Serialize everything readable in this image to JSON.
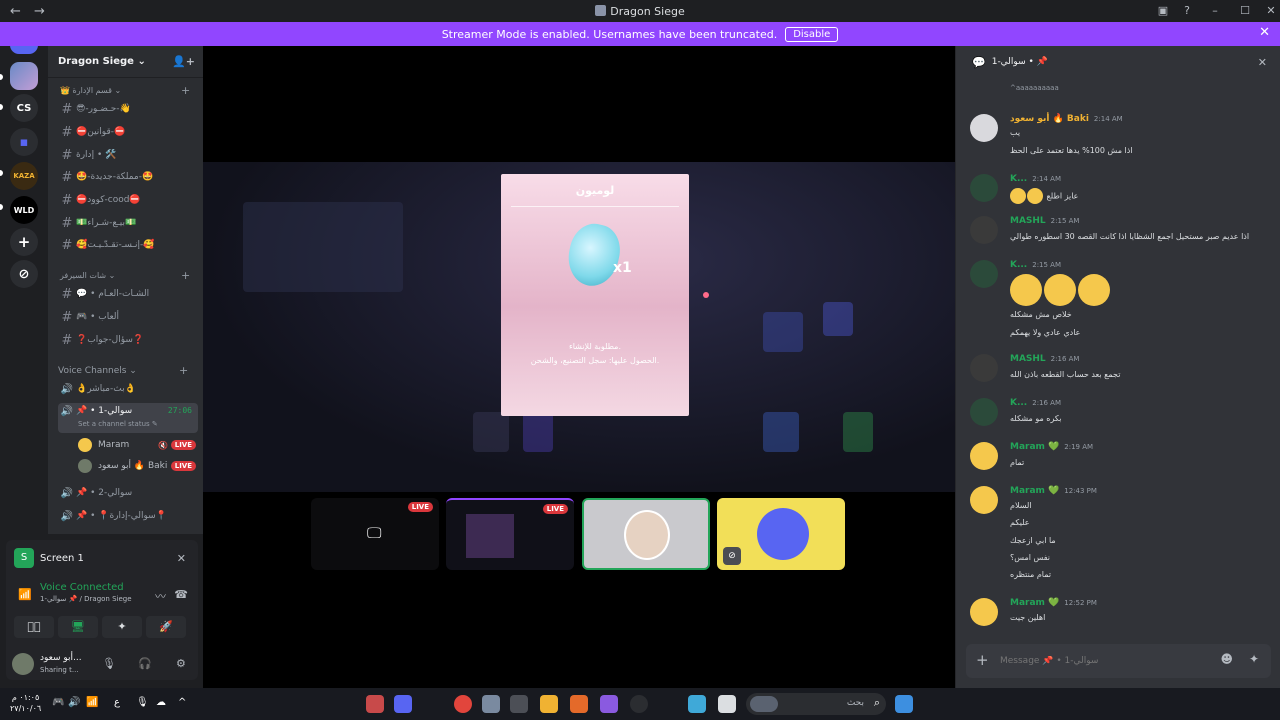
{
  "window": {
    "title": "Dragon Siege",
    "back": "←",
    "forward": "→",
    "min": "–",
    "max": "☐",
    "close": "✕",
    "help": "?",
    "inbox": "▣"
  },
  "banner": {
    "text": "Streamer Mode is enabled. Usernames have been truncated.",
    "button": "Disable",
    "close": "✕"
  },
  "rail": {
    "servers": [
      {
        "label": "CS"
      },
      {
        "label": "KAZA"
      },
      {
        "label": "WLD"
      }
    ],
    "add": "+",
    "explore": "⊘"
  },
  "guild": {
    "name": "Dragon Siege ⌄",
    "invite": "👤+"
  },
  "categories": {
    "admin": "👑 قسم الإدارة ⌄",
    "chat": "شات السيرفر ⌄",
    "voice": "Voice Channels ⌄",
    "plus": "+"
  },
  "text_channels": [
    "😎-حـضـور-👋",
    "⛔قوانين-⛔",
    "إدارة • 🛠️",
    "🤩-مملكة-جديدة-🤩",
    "⛔كوود-cood⛔",
    "💵بيـع-شـراء💵",
    "🥰إنـسـ-تقـدّـيـت-🥰",
    "💬 • الشـات-العـام",
    "🎮 • ألعاب",
    "❓سؤال-جواب❓"
  ],
  "voice_channels": [
    {
      "name": "👌بث-مباشر👌",
      "active": false
    },
    {
      "name": "📌 • سوالي-1",
      "active": true,
      "time": "27:06",
      "status": "Set a channel status ✎"
    },
    {
      "name": "📌 • سوالي-2",
      "active": false
    },
    {
      "name": "📌 • 📍سوالي-إدارة📍",
      "active": false
    }
  ],
  "vc_members": [
    {
      "name": "Maram",
      "badge": "LIVE",
      "icon": "🔇"
    },
    {
      "name": "أبو سعود 🔥 Baki",
      "badge": "LIVE"
    }
  ],
  "voice_panel": {
    "screen_label": "Screen 1",
    "status": "Voice Connected",
    "sub": "سوالي-1 📌 / Dragon Siege",
    "user_name": "أبو سعود...",
    "user_status": "Sharing t...",
    "buttons": [
      "📷⃠",
      "🖥",
      "✦",
      "🚀"
    ],
    "icons": {
      "mic": "🎙",
      "headset": "🎧",
      "gear": "⚙",
      "signal": "📶",
      "noise": "〰",
      "hangup": "☎",
      "close": "✕"
    }
  },
  "stage": {
    "card": {
      "title": "لوميون",
      "qty": "x1",
      "desc1": "مطلوبة للإنشاء.",
      "desc2": "الحصول عليها: سجل التصنيع، والشحن."
    },
    "tiles": [
      {
        "badge": "LIVE"
      },
      {
        "badge": "LIVE"
      },
      {
        "badge": ""
      },
      {
        "badge": ""
      }
    ]
  },
  "chat": {
    "header": "سوالي-1 • 📌",
    "header_close": "✕",
    "top_fragment": "^aaaaaaaaaa",
    "messages": [
      {
        "name": "أبو سعود 🔥 Baki",
        "time": "2:14 AM",
        "color": "#f0b232",
        "lines": [
          "يب",
          "اذا مش 100% يدها تعتمد على الحظ"
        ]
      },
      {
        "name": "K...",
        "time": "2:14 AM",
        "color": "#23a559",
        "lines": [
          "عايز اطلع"
        ],
        "emoji_after": 2
      },
      {
        "name": "MASHL",
        "time": "2:15 AM",
        "color": "#23a559",
        "lines": [
          "اذا عديم صبر مستحيل اجمع الشظايا اذا كانت القصه 30 اسطوره طوالي"
        ]
      },
      {
        "name": "K...",
        "time": "2:15 AM",
        "color": "#23a559",
        "lines": [
          "خلاص مش مشكله",
          "عادي عادي ولا يهمكم"
        ],
        "big_emoji": 3
      },
      {
        "name": "MASHL",
        "time": "2:16 AM",
        "color": "#23a559",
        "lines": [
          "تجمع بعد حساب القطعه باذن الله"
        ]
      },
      {
        "name": "K...",
        "time": "2:16 AM",
        "color": "#23a559",
        "lines": [
          "بكره مو مشكله"
        ]
      },
      {
        "name": "Maram 💚",
        "time": "2:19 AM",
        "color": "#23a559",
        "lines": [
          "تمام"
        ]
      },
      {
        "name": "Maram 💚",
        "time": "12:43 PM",
        "color": "#23a559",
        "lines": [
          "السلام",
          "عليكم",
          "ما ابي ازعجك",
          "نفس امس؟",
          "تمام منتظره"
        ]
      },
      {
        "name": "Maram 💚",
        "time": "12:52 PM",
        "color": "#23a559",
        "lines": [
          "اهلين جيت"
        ]
      }
    ],
    "composer": {
      "placeholder": "Message 📌 • سوالي-1",
      "plus": "+",
      "emoji": "☻",
      "apps": "✦"
    }
  },
  "taskbar": {
    "time": "٠١:٠٥ م",
    "date": "٢٧/١٠/٠٦",
    "lang": "ع",
    "search_placeholder": "بحث",
    "icons": [
      "🎮",
      "🔊",
      "📶",
      "ع",
      "🎙",
      "☁",
      "^"
    ]
  }
}
